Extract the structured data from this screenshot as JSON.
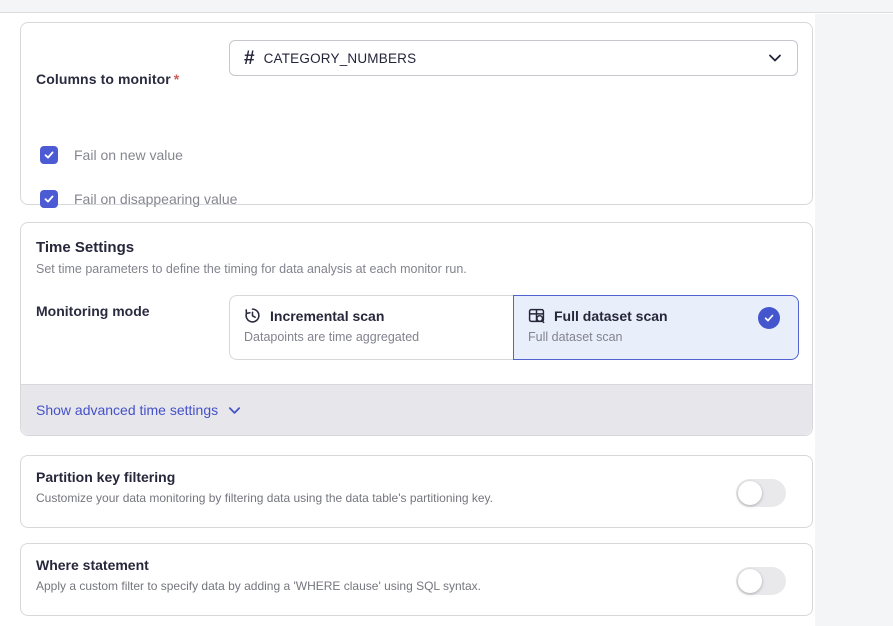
{
  "colors": {
    "primary_blue": "#4c5bd4",
    "badge_blue": "#4456cd",
    "link_blue": "#4451c8",
    "selected_option_bg": "#e9eefb",
    "selected_option_border": "#5163d1",
    "card_border": "#d7d8dc",
    "footer_gray": "#e7e7eb",
    "gutter_gray": "#f4f5f7",
    "text_dark": "#26273a",
    "text_gray": "#82838e",
    "required_red": "#cf5b56"
  },
  "columns_card": {
    "label": "Columns to monitor",
    "required_marker": "*",
    "dropdown": {
      "icon": "hash-icon",
      "icon_glyph": "#",
      "value": "CATEGORY_NUMBERS"
    },
    "checkboxes": [
      {
        "label": "Fail on new value",
        "checked": true
      },
      {
        "label": "Fail on disappearing value",
        "checked": true
      }
    ]
  },
  "time_settings_card": {
    "title": "Time Settings",
    "subtitle": "Set time parameters to define the timing for data analysis at each monitor run.",
    "monitoring_mode_label": "Monitoring mode",
    "options": [
      {
        "icon": "clock-history-icon",
        "title": "Incremental scan",
        "description": "Datapoints are time aggregated",
        "selected": false
      },
      {
        "icon": "table-search-icon",
        "title": "Full dataset scan",
        "description": "Full dataset scan",
        "selected": true
      }
    ],
    "advanced_link_label": "Show advanced time settings"
  },
  "partition_card": {
    "title": "Partition key filtering",
    "description": "Customize your data monitoring by filtering data using the data table's partitioning key.",
    "toggle_on": false
  },
  "where_card": {
    "title": "Where statement",
    "description": "Apply a custom filter to specify data by adding a 'WHERE clause' using SQL syntax.",
    "toggle_on": false
  }
}
